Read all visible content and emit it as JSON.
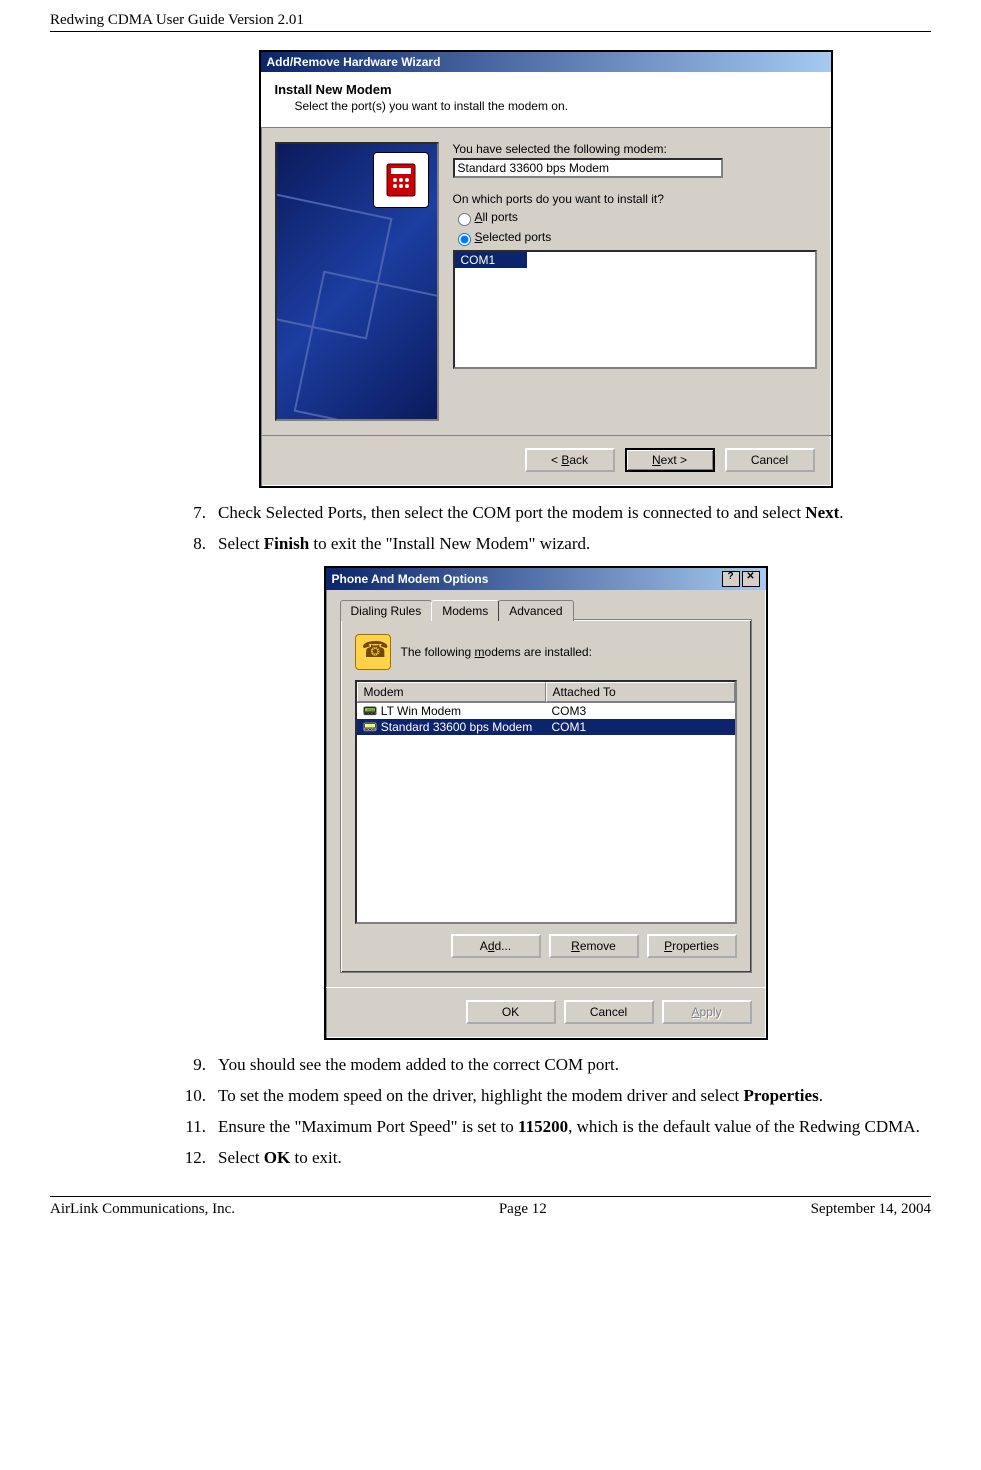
{
  "header": {
    "title": "Redwing CDMA User Guide Version 2.01"
  },
  "wizard": {
    "title": "Add/Remove Hardware Wizard",
    "heading": "Install New Modem",
    "subheading": "Select the port(s) you want to install the modem on.",
    "selected_label": "You have selected the following modem:",
    "modem_name": "Standard 33600 bps Modem",
    "port_prompt": "On which ports do you want to install it?",
    "radio_all": "All ports",
    "radio_selected": "Selected ports",
    "port_item": "COM1",
    "back": "< Back",
    "next": "Next >",
    "cancel": "Cancel"
  },
  "pnm": {
    "title": "Phone And Modem Options",
    "tab1": "Dialing Rules",
    "tab2": "Modems",
    "tab3": "Advanced",
    "intro": "The following modems are  installed:",
    "col_modem": "Modem",
    "col_attached": "Attached To",
    "row1": {
      "modem": "LT Win Modem",
      "port": "COM3"
    },
    "row2": {
      "modem": "Standard 33600 bps Modem",
      "port": "COM1"
    },
    "add": "Add...",
    "remove": "Remove",
    "properties": "Properties",
    "ok": "OK",
    "cancel": "Cancel",
    "apply": "Apply"
  },
  "steps": {
    "s7a": "Check Selected Ports, then select the COM port the modem is connected to and select ",
    "s7b": "Next",
    "s7c": ".",
    "s8a": "Select ",
    "s8b": "Finish",
    "s8c": " to exit the \"Install New Modem\" wizard.",
    "s9": "You should see the modem added to the correct COM port.",
    "s10a": "To set the modem speed on the driver, highlight the modem driver and select ",
    "s10b": "Properties",
    "s10c": ".",
    "s11a": "Ensure the \"Maximum Port Speed\" is set to ",
    "s11b": "115200",
    "s11c": ", which is the default value of the Redwing CDMA.",
    "s12a": "Select ",
    "s12b": "OK",
    "s12c": " to exit."
  },
  "footer": {
    "left": "AirLink Communications, Inc.",
    "center": "Page 12",
    "right": "September 14, 2004"
  }
}
